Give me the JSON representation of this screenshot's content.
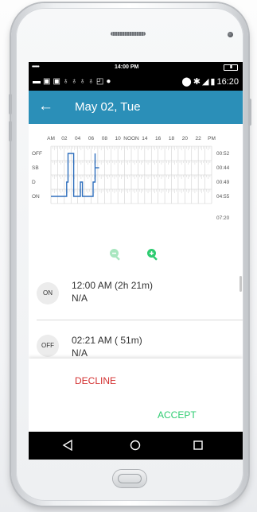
{
  "status": {
    "carrier": "••••••",
    "time_top": "14:00 PM",
    "battery_top": "IIIII",
    "android_time": "16:20",
    "android_icons_left": [
      "message-icon",
      "app-icon",
      "app-icon",
      "location-pin-icon",
      "location-pin-icon",
      "location-pin-icon",
      "location-pin-icon",
      "image-icon",
      "circle-icon"
    ],
    "android_icons_right": [
      "location-icon",
      "bluetooth-icon",
      "signal-icon",
      "battery-icon"
    ]
  },
  "appbar": {
    "title": "May 02, Tue",
    "back_icon": "arrow-left-icon"
  },
  "chart_data": {
    "type": "line",
    "x_ticks": [
      "AM",
      "02",
      "04",
      "06",
      "08",
      "10",
      "NOON",
      "14",
      "16",
      "18",
      "20",
      "22",
      "PM"
    ],
    "rows": [
      "OFF",
      "SB",
      "D",
      "ON"
    ],
    "totals": [
      "00:52",
      "00:44",
      "00:49",
      "04:55"
    ],
    "grand_total": "07:20",
    "xlim": [
      0,
      24
    ],
    "series": [
      {
        "values": [
          {
            "x": 0.0,
            "y": "ON"
          },
          {
            "x": 2.35,
            "y": "ON"
          },
          {
            "x": 2.35,
            "y": "D"
          },
          {
            "x": 2.55,
            "y": "D"
          },
          {
            "x": 2.55,
            "y": "OFF"
          },
          {
            "x": 3.4,
            "y": "OFF"
          },
          {
            "x": 3.4,
            "y": "ON"
          },
          {
            "x": 4.4,
            "y": "ON"
          },
          {
            "x": 4.4,
            "y": "D"
          },
          {
            "x": 4.7,
            "y": "D"
          },
          {
            "x": 4.7,
            "y": "ON"
          },
          {
            "x": 6.3,
            "y": "ON"
          },
          {
            "x": 6.3,
            "y": "D"
          },
          {
            "x": 6.6,
            "y": "D"
          },
          {
            "x": 6.6,
            "y": "OFF"
          }
        ]
      },
      {
        "values": [
          {
            "x": 6.6,
            "y": "SB"
          },
          {
            "x": 7.2,
            "y": "SB"
          }
        ]
      }
    ],
    "colors": {
      "line": "#2f6fbd",
      "grid": "#d0d0d0"
    }
  },
  "zoom": {
    "out_icon": "zoom-out-icon",
    "in_icon": "zoom-in-icon"
  },
  "logs": [
    {
      "status": "ON",
      "time": "12:00 AM (2h 21m)",
      "location": "N/A"
    },
    {
      "status": "OFF",
      "time": "02:21 AM ( 51m)",
      "location": "N/A"
    }
  ],
  "actions": {
    "decline": "DECLINE",
    "accept": "ACCEPT"
  },
  "navbar": {
    "back_icon": "triangle-back-icon",
    "home_icon": "circle-home-icon",
    "recents_icon": "square-recents-icon"
  }
}
